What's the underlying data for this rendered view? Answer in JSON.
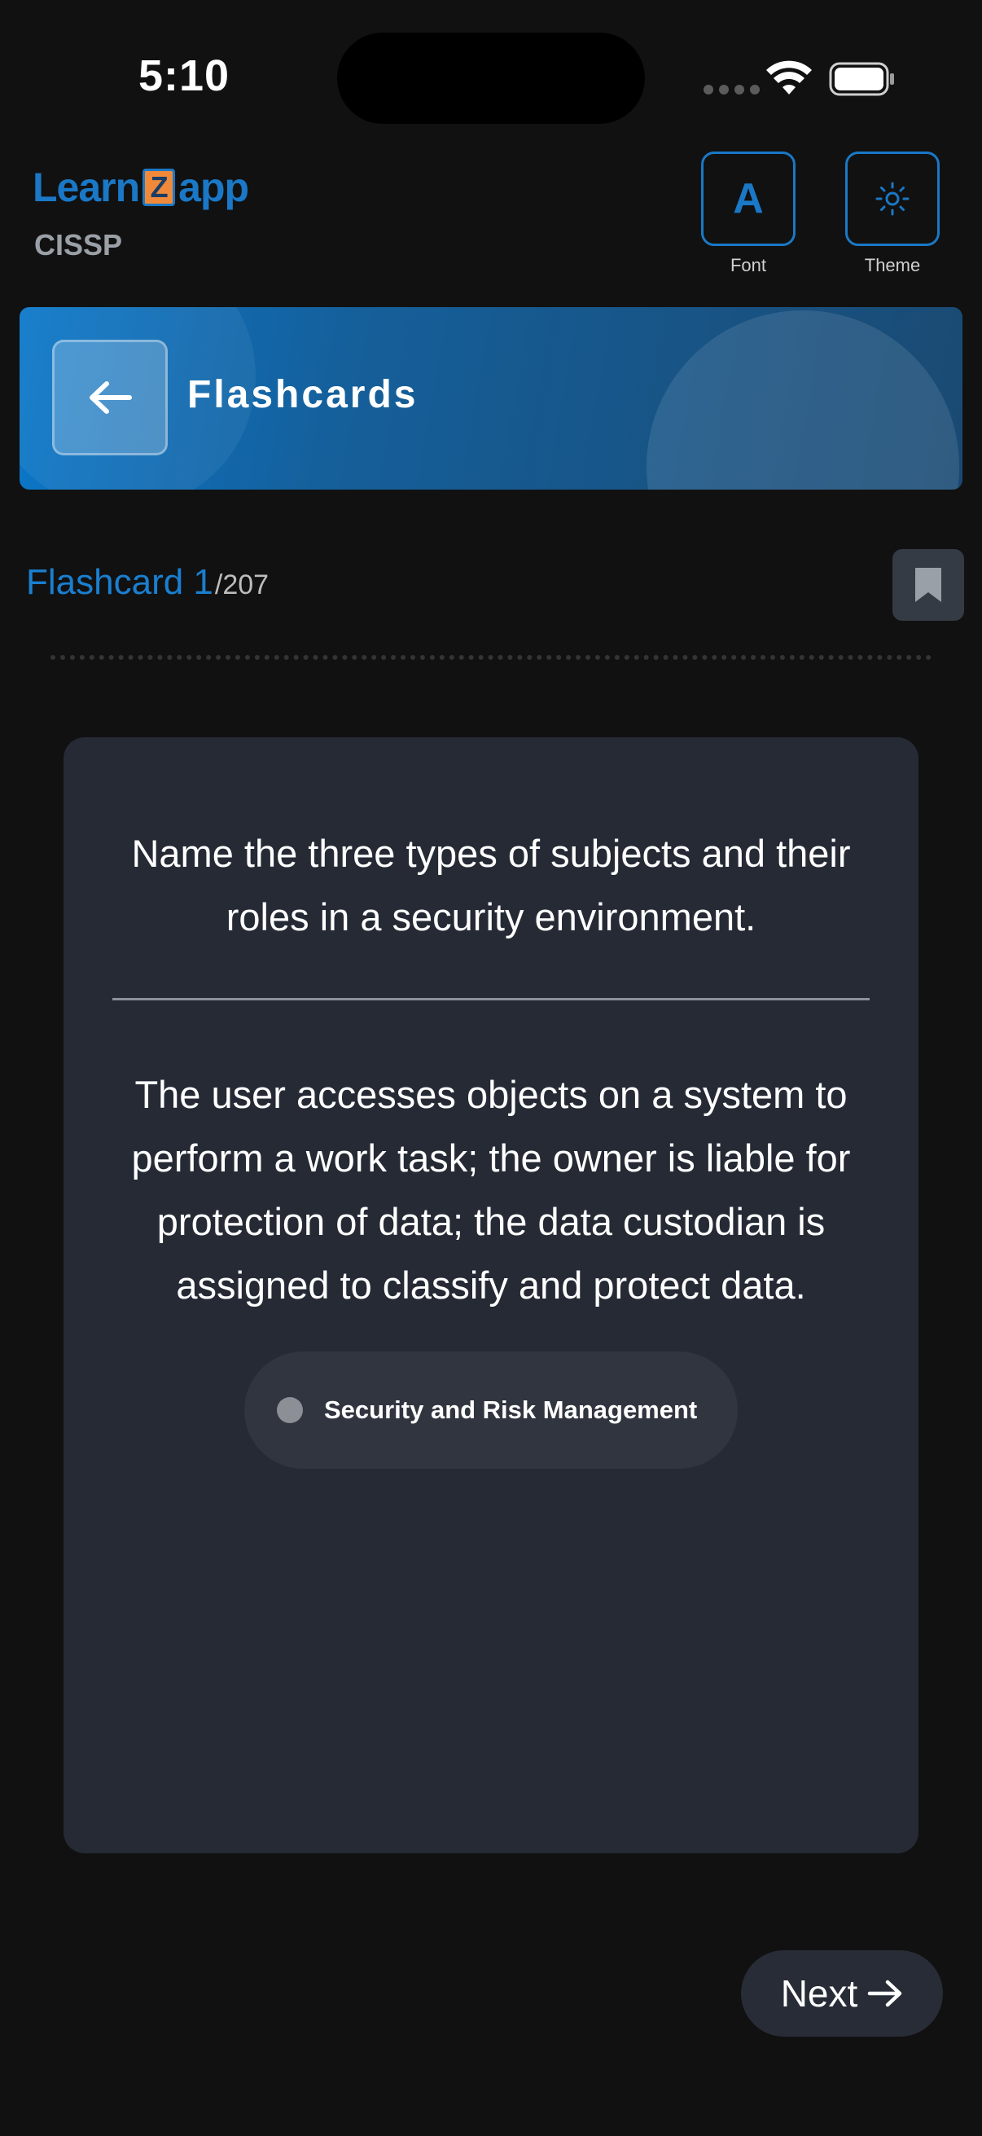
{
  "status_bar": {
    "time": "5:10"
  },
  "header": {
    "logo_left": "Learn",
    "logo_mid": "Z",
    "logo_right": "app",
    "subtitle": "CISSP",
    "font_button_glyph": "A",
    "font_label": "Font",
    "theme_label": "Theme",
    "icons": [
      "font-icon",
      "sun-icon"
    ]
  },
  "banner": {
    "title": "Flashcards",
    "back_icon": "arrow-left-icon"
  },
  "counter": {
    "label": "Flashcard 1",
    "total": "/207",
    "bookmark_icon": "bookmark-icon"
  },
  "card": {
    "question": "Name the three types of subjects and their roles in a security environment.",
    "answer": "The user accesses objects on a system to perform a work task; the owner is liable for protection of data; the data custodian is assigned to classify and protect data.",
    "topic": "Security and Risk Management"
  },
  "footer": {
    "next_label": "Next",
    "next_icon": "arrow-right-icon"
  },
  "colors": {
    "background": "#111111",
    "accent": "#1a78c6",
    "card": "#252a35",
    "chip": "#30353f"
  }
}
